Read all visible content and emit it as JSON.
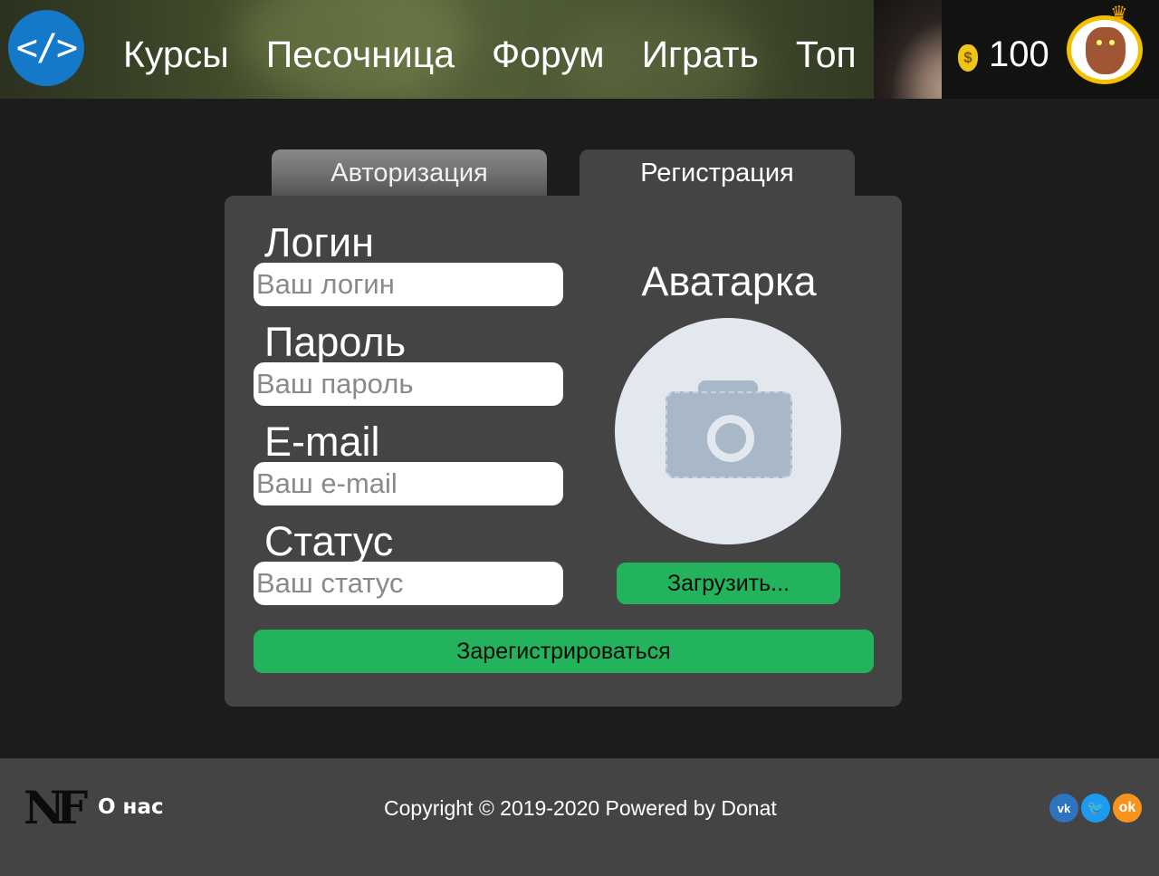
{
  "header": {
    "logo_text": "</>",
    "nav": [
      "Курсы",
      "Песочница",
      "Форум",
      "Играть",
      "Топ"
    ],
    "currency_icon": "$",
    "coins": "100"
  },
  "tabs": {
    "login": "Авторизация",
    "register": "Регистрация"
  },
  "form": {
    "login_label": "Логин",
    "login_placeholder": "Ваш логин",
    "password_label": "Пароль",
    "password_placeholder": "Ваш пароль",
    "email_label": "E-mail",
    "email_placeholder": "Ваш e-mail",
    "status_label": "Статус",
    "status_placeholder": "Ваш статус",
    "submit_label": "Зарегистрироваться"
  },
  "avatar": {
    "title": "Аватарка",
    "upload_label": "Загрузить..."
  },
  "footer": {
    "logo_text": "NF",
    "about_label": "О нас",
    "copyright": "Copyright © 2019-2020 Powered by Donat",
    "social": [
      "vk-icon",
      "twitter-icon",
      "odnoklassniki-icon"
    ]
  },
  "colors": {
    "accent_green": "#22b35c",
    "logo_blue": "#1479c8",
    "panel_bg": "#444444",
    "page_bg": "#1c1c1c"
  }
}
